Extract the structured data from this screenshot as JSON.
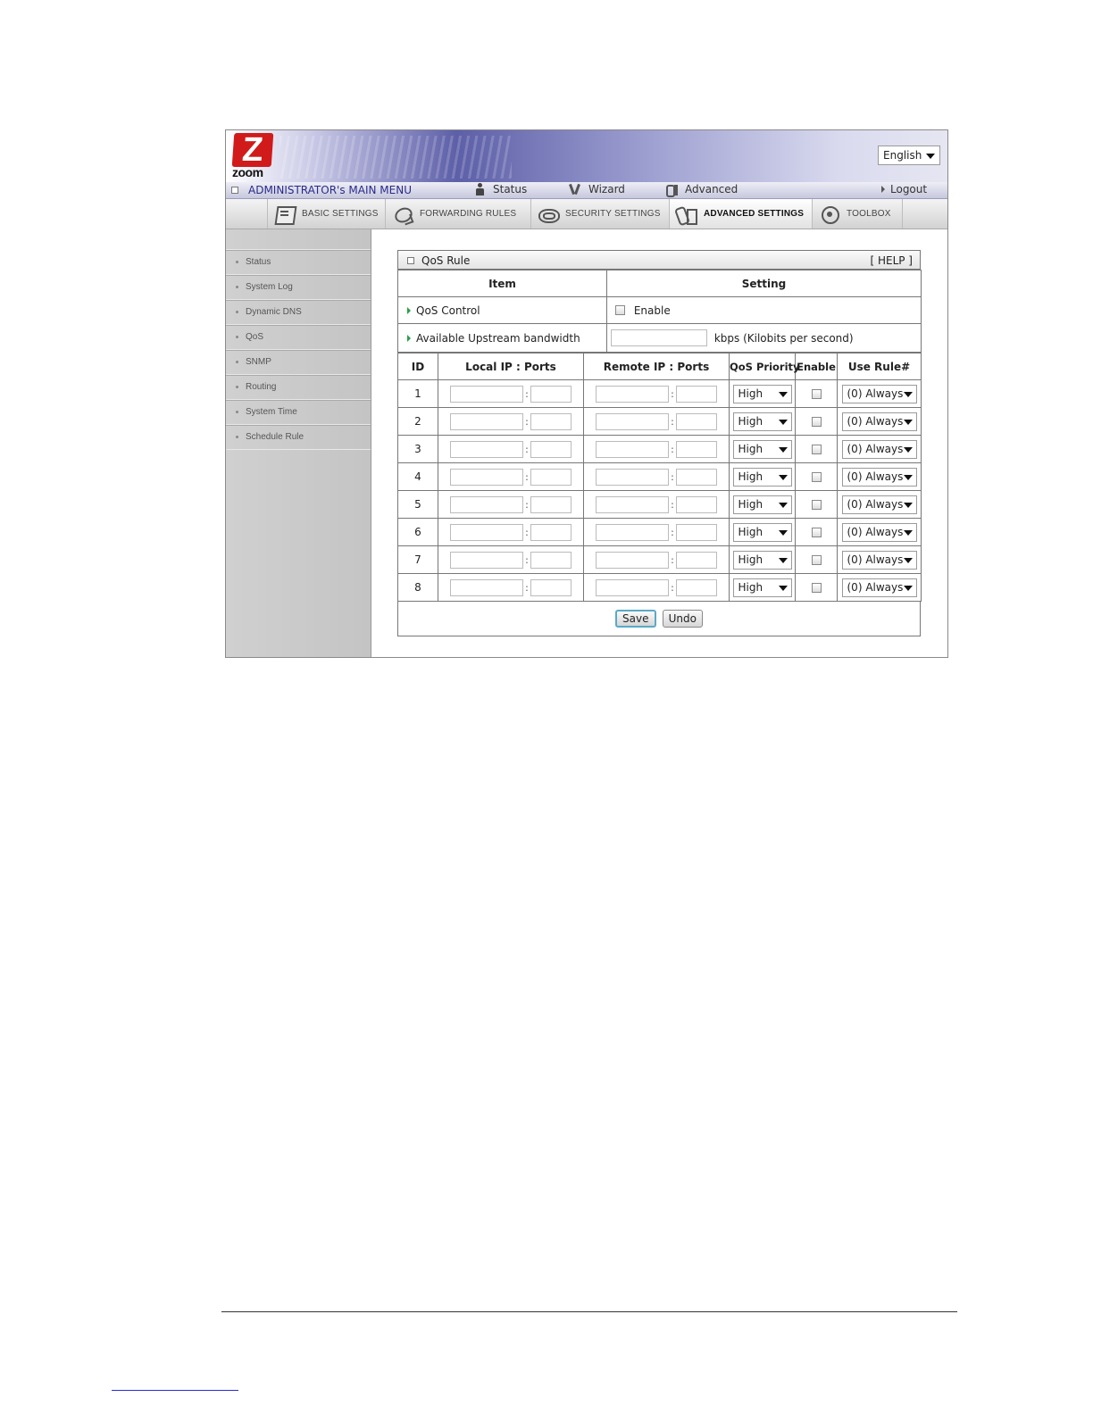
{
  "language_select": {
    "value": "English"
  },
  "main_menu": {
    "title": "ADMINISTRATOR's MAIN MENU",
    "items": [
      {
        "label": "Status",
        "icon": "person-icon"
      },
      {
        "label": "Wizard",
        "icon": "wand-icon"
      },
      {
        "label": "Advanced",
        "icon": "tools-icon"
      }
    ],
    "logout": "Logout"
  },
  "logo": {
    "letter": "Z",
    "text": "zoom"
  },
  "tabs": [
    {
      "label": "Basic Settings",
      "icon": "basic-settings-icon",
      "active": false
    },
    {
      "label": "Forwarding Rules",
      "icon": "forwarding-rules-icon",
      "active": false
    },
    {
      "label": "Security Settings",
      "icon": "security-settings-icon",
      "active": false
    },
    {
      "label": "Advanced Settings",
      "icon": "advanced-settings-icon",
      "active": true
    },
    {
      "label": "Toolbox",
      "icon": "toolbox-icon",
      "active": false
    }
  ],
  "sidebar": {
    "items": [
      "Status",
      "System Log",
      "Dynamic DNS",
      "QoS",
      "SNMP",
      "Routing",
      "System Time",
      "Schedule Rule"
    ]
  },
  "qos": {
    "title": "QoS Rule",
    "help": "[ HELP ]",
    "headers": {
      "item": "Item",
      "setting": "Setting"
    },
    "control": {
      "label": "QoS Control",
      "enable_label": "Enable"
    },
    "bandwidth": {
      "label": "Available Upstream bandwidth",
      "unit": "kbps (Kilobits per second)",
      "value": ""
    },
    "columns": {
      "id": "ID",
      "local": "Local IP : Ports",
      "remote": "Remote IP : Ports",
      "priority": "QoS Priority",
      "enable": "Enable",
      "rule": "Use Rule#"
    },
    "colon": ":",
    "rows": [
      {
        "id": "1",
        "priority": "High",
        "rule": "(0) Always"
      },
      {
        "id": "2",
        "priority": "High",
        "rule": "(0) Always"
      },
      {
        "id": "3",
        "priority": "High",
        "rule": "(0) Always"
      },
      {
        "id": "4",
        "priority": "High",
        "rule": "(0) Always"
      },
      {
        "id": "5",
        "priority": "High",
        "rule": "(0) Always"
      },
      {
        "id": "6",
        "priority": "High",
        "rule": "(0) Always"
      },
      {
        "id": "7",
        "priority": "High",
        "rule": "(0) Always"
      },
      {
        "id": "8",
        "priority": "High",
        "rule": "(0) Always"
      }
    ],
    "save_label": "Save",
    "undo_label": "Undo"
  },
  "colors": {
    "brand_red": "#d11a1a",
    "menu_title_blue": "#2a2a8a",
    "item_arrow_green": "#2a9d4a",
    "save_border": "#5aa9c7"
  }
}
